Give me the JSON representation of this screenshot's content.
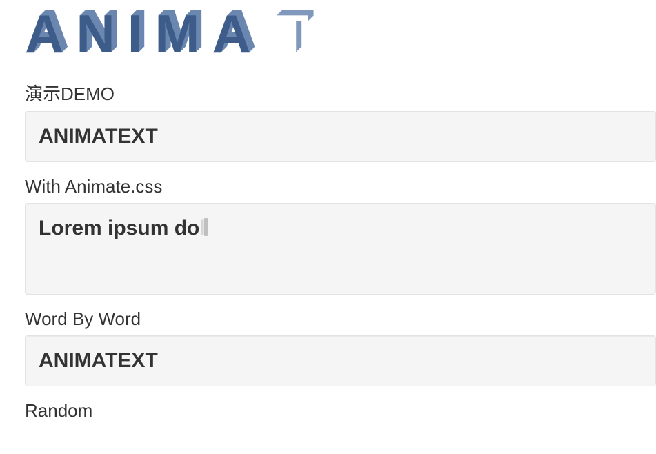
{
  "hero": {
    "full_text": "ANIMATEXT",
    "visible_solid": "ANIMA",
    "visible_partial": "T"
  },
  "sections": {
    "demo": {
      "label": "演示DEMO",
      "text": "ANIMATEXT"
    },
    "animatecss": {
      "label": "With Animate.css",
      "text_visible": "Lorem ipsum do",
      "text_next_char": "l"
    },
    "wordbyword": {
      "label": "Word By Word",
      "text": "ANIMATEXT"
    },
    "random": {
      "label": "Random"
    }
  }
}
